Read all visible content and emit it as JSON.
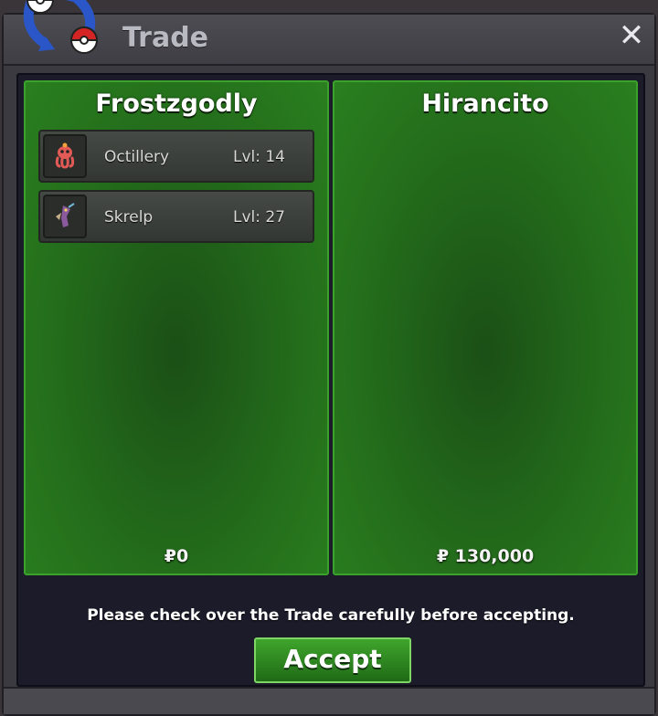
{
  "window": {
    "title": "Trade",
    "close_icon": "close-icon",
    "logo_icon": "pokeball-trade-arrows-icon"
  },
  "left_side": {
    "player": "Frostzgodly",
    "money": "₽0",
    "pokemon": [
      {
        "name": "Octillery",
        "level": "Lvl: 14",
        "sprite": "octillery-sprite-icon",
        "color": "#e25a55"
      },
      {
        "name": "Skrelp",
        "level": "Lvl: 27",
        "sprite": "skrelp-sprite-icon",
        "color": "#8a5a9c"
      }
    ]
  },
  "right_side": {
    "player": "Hirancito",
    "money": "₽ 130,000",
    "pokemon": []
  },
  "notice": "Please check over the Trade carefully before accepting.",
  "accept_label": "Accept",
  "colors": {
    "panel_green": "#236c1b",
    "panel_border": "#3aa22a",
    "accept_green": "#3fa52c",
    "window_bg": "#3b3a40"
  }
}
